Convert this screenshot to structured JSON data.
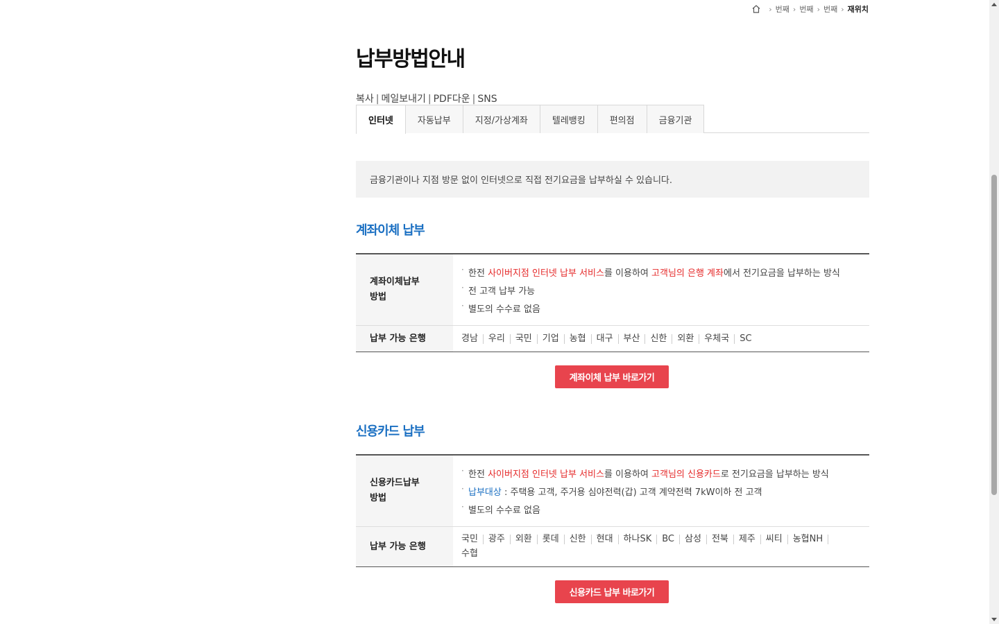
{
  "breadcrumb": {
    "items": [
      "번째",
      "번째",
      "번째"
    ],
    "current": "재위치"
  },
  "page": {
    "title": "납부방법안내"
  },
  "util_links": [
    "복사",
    "메일보내기",
    "PDF다운",
    "SNS"
  ],
  "tabs": [
    {
      "label": "인터넷",
      "active": true
    },
    {
      "label": "자동납부"
    },
    {
      "label": "지정/가상계좌"
    },
    {
      "label": "텔레뱅킹"
    },
    {
      "label": "편의점"
    },
    {
      "label": "금융기관"
    }
  ],
  "intro": "금융기관이나 지점 방문 없이 인터넷으로 직접 전기요금을 납부하실 수 있습니다.",
  "account_section": {
    "title": "계좌이체 납부",
    "method_header_line1": "계좌이체납부",
    "method_header_line2": "방법",
    "line1": {
      "a": "한전 ",
      "b": "사이버지점 인터넷 납부 서비스",
      "c": "를 이용하여 ",
      "d": "고객님의 은행 계좌",
      "e": "에서 전기요금을 납부하는 방식"
    },
    "line2": "전 고객 납부 가능",
    "line3": "별도의 수수료 없음",
    "banks_header": "납부 가능 은행",
    "banks": [
      "경남",
      "우리",
      "국민",
      "기업",
      "농협",
      "대구",
      "부산",
      "신한",
      "외환",
      "우체국",
      "SC"
    ],
    "button": "계좌이체 납부 바로가기"
  },
  "card_section": {
    "title": "신용카드 납부",
    "method_header_line1": "신용카드납부",
    "method_header_line2": "방법",
    "line1": {
      "a": "한전 ",
      "b": "사이버지점 인터넷 납부 서비스",
      "c": "를 이용하여 ",
      "d": "고객님의 신용카드",
      "e": "로 전기요금을 납부하는 방식"
    },
    "line2": {
      "a": "납부대상",
      "b": " : 주택용 고객, 주거용 심야전력(갑) 고객 계약전력 7kW이하 전 고객"
    },
    "line3": "별도의 수수료 없음",
    "banks_header": "납부 가능 은행",
    "banks": [
      "국민",
      "광주",
      "외환",
      "롯데",
      "신한",
      "현대",
      "하나SK",
      "BC",
      "삼성",
      "전북",
      "제주",
      "씨티",
      "농협NH",
      "수협"
    ],
    "button": "신용카드 납부 바로가기"
  },
  "colors": {
    "accent_blue": "#1a6fc2",
    "accent_red": "#e52a2a",
    "button_red": "#e8444d"
  }
}
